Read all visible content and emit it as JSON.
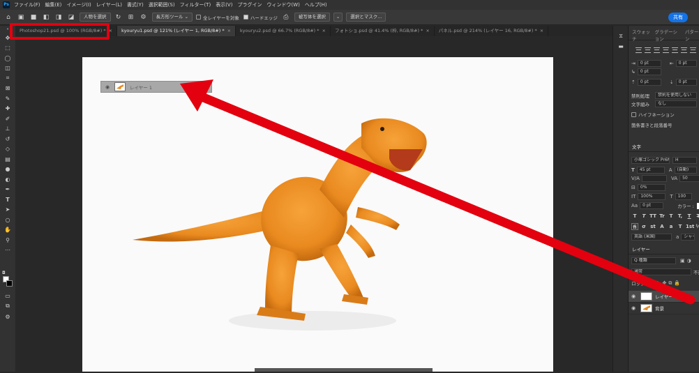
{
  "app": {
    "logo": "Ps",
    "share_label": "共有"
  },
  "menu": [
    "ファイル(F)",
    "編集(E)",
    "イメージ(I)",
    "レイヤー(L)",
    "書式(Y)",
    "選択範囲(S)",
    "フィルター(T)",
    "表示(V)",
    "プラグイン",
    "ウィンドウ(W)",
    "ヘルプ(H)"
  ],
  "options": {
    "select_subject": "人物を選択",
    "tool_mode": "長方形ツール",
    "all_layers": "全レイヤーを対象",
    "hard_edge": "ハードエッジ",
    "select_subject_btn": "被写体を選択",
    "select_mask": "選択とマスク..."
  },
  "tabs": [
    {
      "label": "Photoshop21.psd @ 100% (RGB/8#) *",
      "close": "×"
    },
    {
      "label": "kyouryu1.psd @ 121% (レイヤー 1, RGB/8#) *",
      "close": "×"
    },
    {
      "label": "kyouryu2.psd @ 66.7% (RGB/8#) *",
      "close": "×"
    },
    {
      "label": "フォトショ.psd @ 41.4% (枠, RGB/8#) *",
      "close": "×"
    },
    {
      "label": "パネル.psd @ 214% (レイヤー 16, RGB/8#) *",
      "close": "×"
    }
  ],
  "floating_layer": {
    "name": "レイヤー 1"
  },
  "panel": {
    "top_tabs": [
      "スウォッチ",
      "グラデーション",
      "パターン"
    ],
    "indent_left": "0 pt",
    "indent_right": "0 pt",
    "indent_first": "0 pt",
    "space_before": "0 pt",
    "space_after": "0 pt",
    "kinsoku_label": "禁則処理",
    "kinsoku_value": "禁則を使用しない",
    "mojikumi_label": "文字組み",
    "mojikumi_value": "なし",
    "hyphenation": "ハイフネーション",
    "numbering": "箇条書きと段落番号",
    "char_tab": "文字",
    "font_family": "小塚ゴシック Pr6N",
    "font_style": "H",
    "font_size": "45 pt",
    "leading": "(自動)",
    "kerning": "",
    "tracking": "50",
    "tsume": "0%",
    "vscale": "100%",
    "hscale": "100",
    "baseline": "0 pt",
    "color_label": "カラー :",
    "language": "英語 (米国)",
    "aa": "シャー",
    "style_buttons": [
      "T",
      "T",
      "TT",
      "Tr",
      "T",
      "T,",
      "T",
      "T"
    ],
    "layers_tab": "レイヤー",
    "filter_kind": "Q 種類",
    "blend_mode": "通常",
    "opacity_label": "不透",
    "lock_label": "ロック :",
    "layers": [
      {
        "name": "レイヤー 1",
        "selected": true
      },
      {
        "name": "背景",
        "selected": false
      }
    ]
  },
  "colors": {
    "highlight": "#e3000f",
    "accent": "#1473e6",
    "dino": "#e98a1f"
  }
}
